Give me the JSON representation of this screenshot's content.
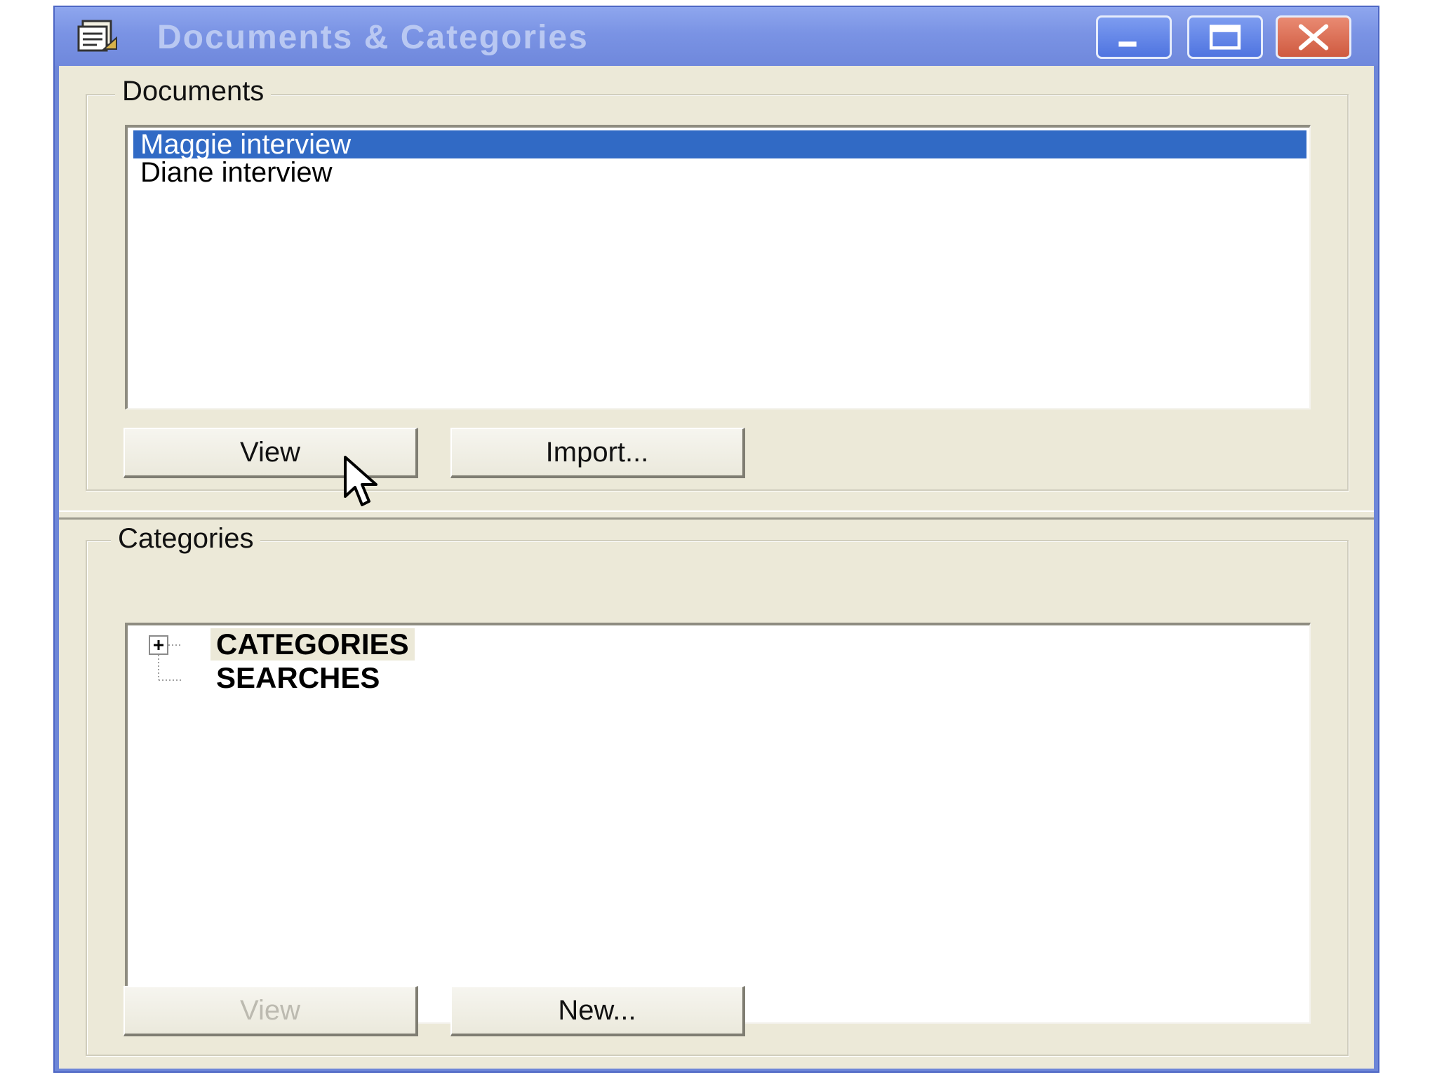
{
  "window": {
    "title": "Documents & Categories",
    "colors": {
      "titlebar": "#7a93e4",
      "client": "#ece9d8",
      "selection": "#316ac5",
      "close": "#cf5a40"
    }
  },
  "titlebar_buttons": {
    "minimize_icon": "minimize-icon",
    "maximize_icon": "maximize-icon",
    "close_icon": "close-icon"
  },
  "documents": {
    "group_label": "Documents",
    "items": [
      {
        "label": "Maggie interview",
        "selected": true
      },
      {
        "label": "Diane interview",
        "selected": false
      }
    ],
    "view_button": "View",
    "import_button": "Import..."
  },
  "categories": {
    "group_label": "Categories",
    "tree": [
      {
        "label": "CATEGORIES",
        "expandable": true
      },
      {
        "label": "SEARCHES",
        "expandable": false
      }
    ],
    "view_button": "View",
    "view_disabled": true,
    "new_button": "New..."
  }
}
